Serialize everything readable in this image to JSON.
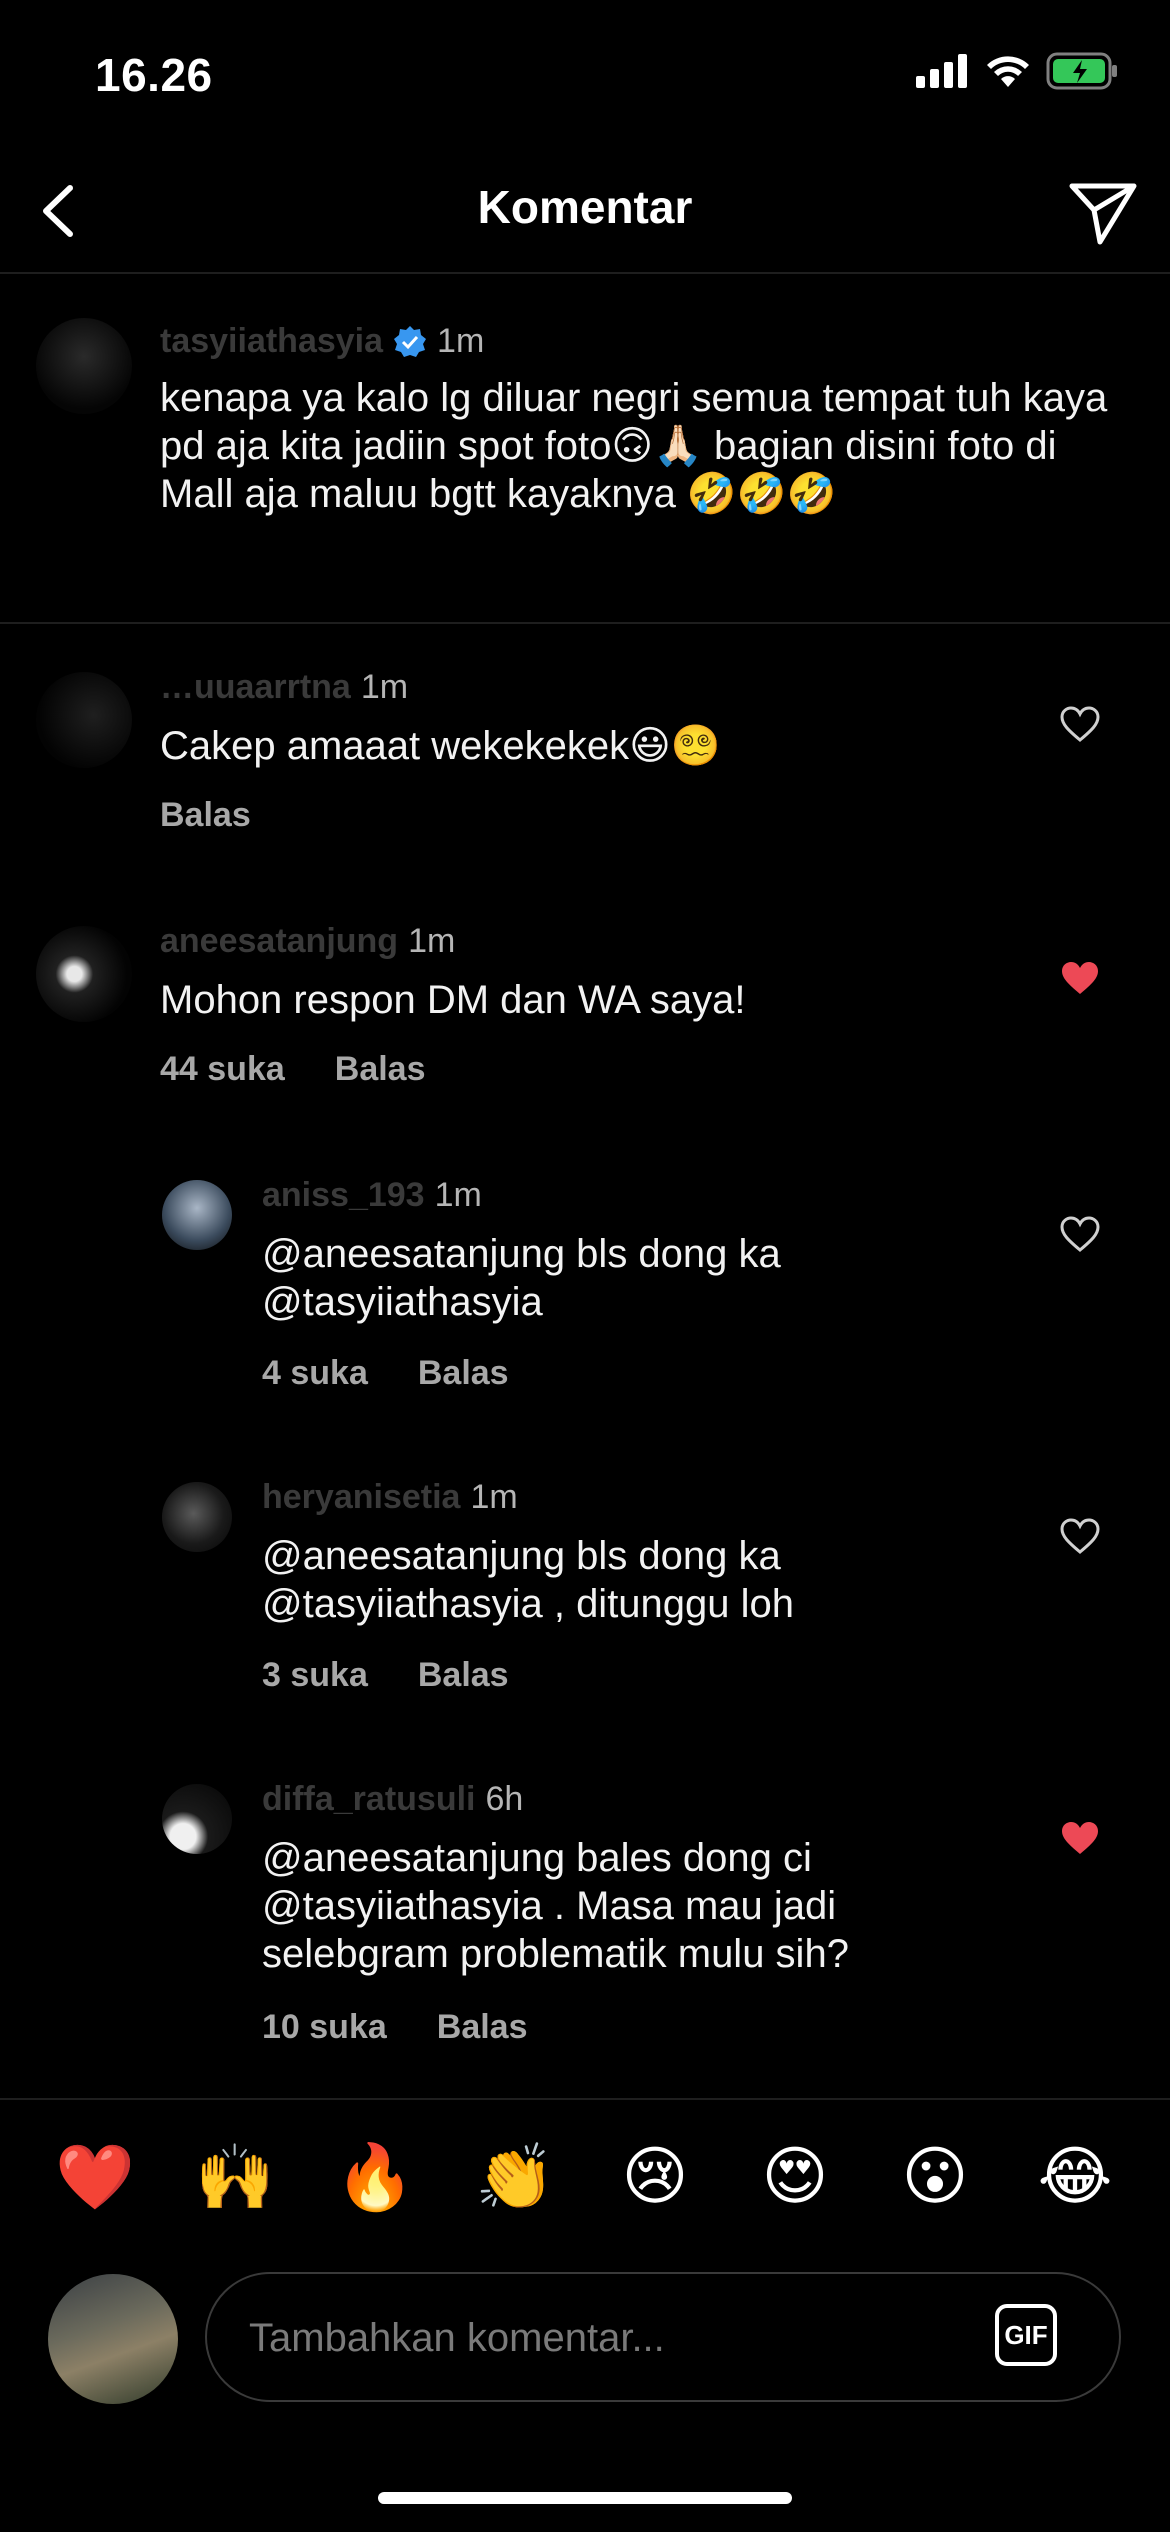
{
  "status_bar": {
    "time": "16.26"
  },
  "header": {
    "title": "Komentar"
  },
  "caption": {
    "username": "tasyiiathasyia",
    "time": "1m",
    "text": "kenapa ya kalo lg diluar negri semua tempat tuh kaya pd aja kita jadiin spot foto🙃🙏🏻 bagian disini  foto di Mall aja maluu bgtt kayaknya 🤣🤣🤣"
  },
  "comments": [
    {
      "username": "…uuaarrtna",
      "time": "1m",
      "text": "Cakep amaaat wekekekek😃😵‍💫",
      "likes": "",
      "reply": "Balas",
      "liked": false
    },
    {
      "username": "aneesatanjung",
      "time": "1m",
      "text": "Mohon respon DM dan WA saya!",
      "likes": "44 suka",
      "reply": "Balas",
      "liked": true
    },
    {
      "username": "aniss_193",
      "time": "1m",
      "text": "@aneesatanjung bls dong ka @tasyiiathasyia",
      "likes": "4 suka",
      "reply": "Balas",
      "liked": false
    },
    {
      "username": "heryanisetia",
      "time": "1m",
      "text": "@aneesatanjung bls dong ka @tasyiiathasyia , ditunggu loh",
      "likes": "3 suka",
      "reply": "Balas",
      "liked": false
    },
    {
      "username": "diffa_ratusuli",
      "time": "6h",
      "text": "@aneesatanjung bales dong ci @tasyiiathasyia . Masa mau jadi selebgram problematik mulu sih?",
      "likes": "10 suka",
      "reply": "Balas",
      "liked": true
    }
  ],
  "emoji_bar": [
    "❤️",
    "🙌",
    "🔥",
    "👏",
    "😢",
    "😍",
    "😮",
    "😂"
  ],
  "composer": {
    "placeholder": "Tambahkan komentar...",
    "gif_label": "GIF"
  },
  "colors": {
    "like_active": "#ed4956",
    "background": "#000000"
  }
}
